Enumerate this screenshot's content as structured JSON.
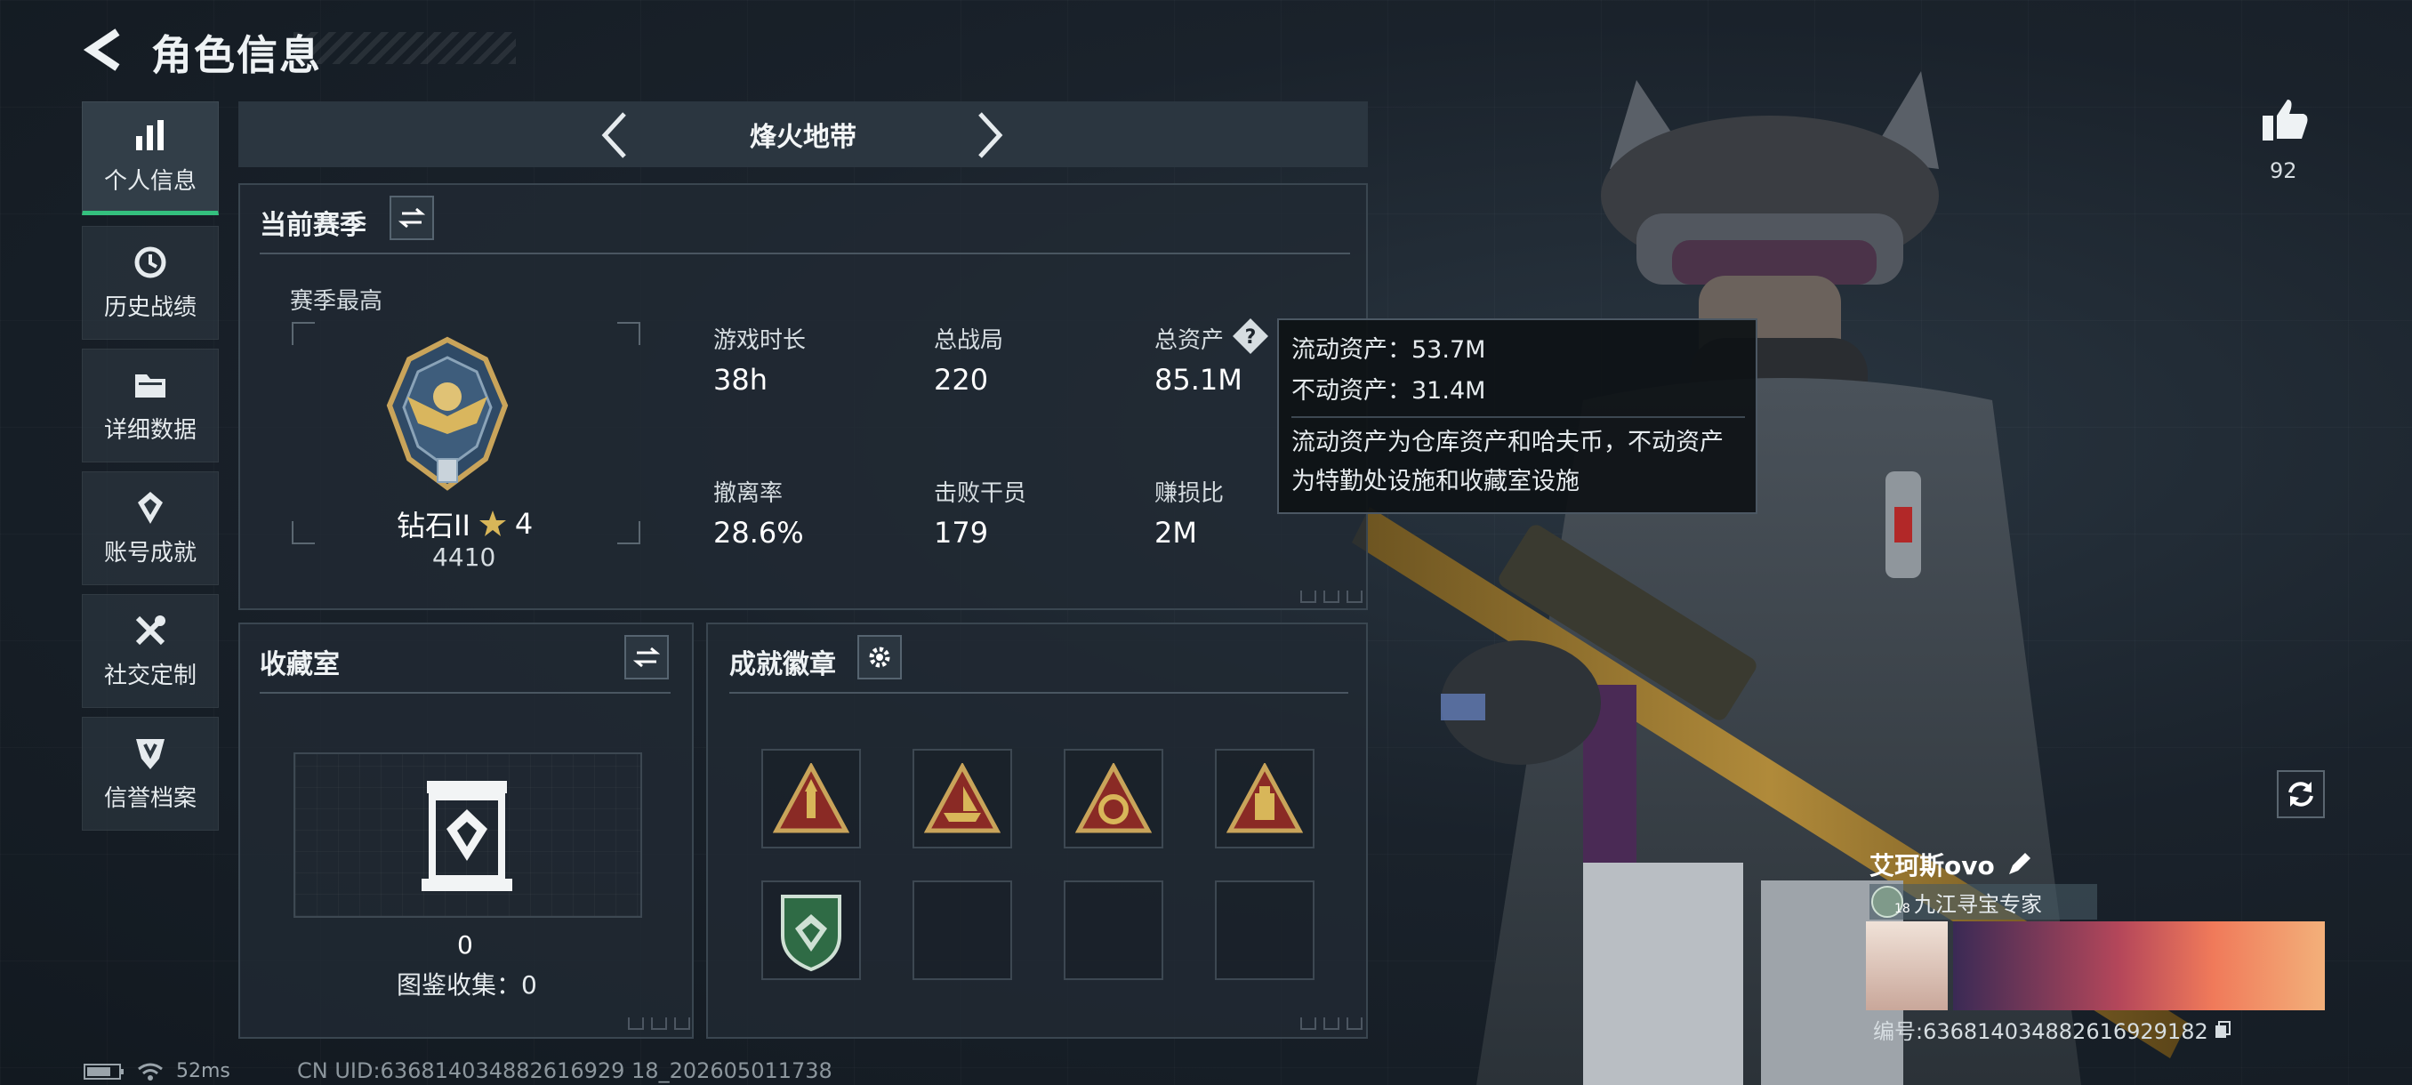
{
  "header": {
    "title": "角色信息"
  },
  "sidebar": {
    "items": [
      {
        "label": "个人信息",
        "icon": "bar-chart-icon",
        "active": true
      },
      {
        "label": "历史战绩",
        "icon": "history-icon"
      },
      {
        "label": "详细数据",
        "icon": "folder-icon"
      },
      {
        "label": "账号成就",
        "icon": "achievement-icon"
      },
      {
        "label": "社交定制",
        "icon": "tools-icon"
      },
      {
        "label": "信誉档案",
        "icon": "shield-icon"
      }
    ]
  },
  "mode": {
    "label": "烽火地带"
  },
  "season": {
    "title": "当前赛季",
    "best_label": "赛季最高",
    "rank_name": "钻石II",
    "rank_stars": "4",
    "rank_score": "4410",
    "stats": [
      {
        "label": "游戏时长",
        "value": "38h"
      },
      {
        "label": "总战局",
        "value": "220"
      },
      {
        "label": "总资产",
        "value": "85.1M"
      },
      {
        "label": "撤离率",
        "value": "28.6%"
      },
      {
        "label": "击败干员",
        "value": "179"
      },
      {
        "label": "赚损比",
        "value": "2M"
      }
    ]
  },
  "tooltip": {
    "liquid": "流动资产：53.7M",
    "fixed": "不动资产：31.4M",
    "desc_line1": "流动资产为仓库资产和哈夫币，不动资产",
    "desc_line2": "为特勤处设施和收藏室设施"
  },
  "collection": {
    "title": "收藏室",
    "count": "0",
    "codex": "图鉴收集：0"
  },
  "achievements": {
    "title": "成就徽章"
  },
  "likes": {
    "count": "92"
  },
  "player": {
    "name": "艾珂斯ovo",
    "level": "18",
    "title_badge": "九江寻宝专家",
    "id_text": "编号:636814034882616929182"
  },
  "status": {
    "ping": "52ms",
    "uid": "CN UID:636814034882616929 18_202605011738"
  },
  "colors": {
    "accent": "#34c07e",
    "badge_gold": "#c9a45a",
    "badge_red": "#8a2a25"
  }
}
